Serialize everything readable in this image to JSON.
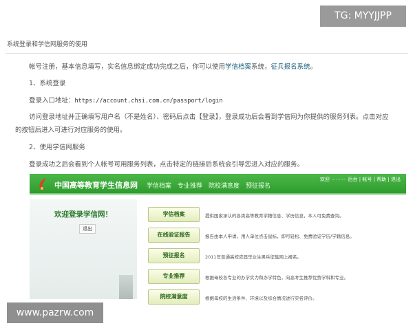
{
  "watermark_top": "TG: MYYJJPP",
  "watermark_bottom": "www.pazrw.com",
  "section_title": "系统登录和学信网服务的使用",
  "paragraphs": {
    "intro_prefix": "帐号注册，基本信息填写，实名信息绑定成功完成之后，你可以使用",
    "intro_link1": "学信档案",
    "intro_mid": "系统，",
    "intro_link2": "征兵报名系统",
    "intro_end": "。",
    "h1": "1、系统登录",
    "login_label": "登录入口地址：",
    "login_url": "https://account.chsi.com.cn/passport/login",
    "login_desc1": "访问登录地址并正确填写用户名（不是姓名）、密码后点击【登录】，登录成功后会看到学信网为你提供的服务列表。点击对应",
    "login_desc2": "的按钮后进入可进行对应服务的使用。",
    "h2": "2、使用学信网服务",
    "service_desc": "登录成功之后会看到个人帐号可用服务列表，点击特定的链接后系统会引导您进入对应的服务。"
  },
  "banner": {
    "site_name": "中国高等教育学生信息网",
    "nav": [
      "学信档案",
      "专业推荐",
      "院校满意度",
      "预征报名"
    ],
    "welcome": "欢迎 ··········  后台 | 帐号 | 帮助 | 退出",
    "color": "#3aa83a"
  },
  "panel": {
    "welcome": "欢迎登录学信网！",
    "logout": "退出"
  },
  "services": [
    {
      "label": "学信档案",
      "desc": "提供国家承认的各类高等教育学籍信息、学历信息，本人可免费查询。"
    },
    {
      "label": "在线验证报告",
      "desc": "报告由本人申请，用人单位点击鼠标，即可轻松、免费验证学历/学籍信息。"
    },
    {
      "label": "预征报名",
      "desc": "2011年普通高校应届毕业生男兵征集网上报名。"
    },
    {
      "label": "专业推荐",
      "desc": "根据母校各专业的办学实力和办学特色，向高考生推荐优势学科和专业。"
    },
    {
      "label": "院校满意度",
      "desc": "根据母校的生活条件、环境以及综合情况进行实名评价。"
    }
  ]
}
